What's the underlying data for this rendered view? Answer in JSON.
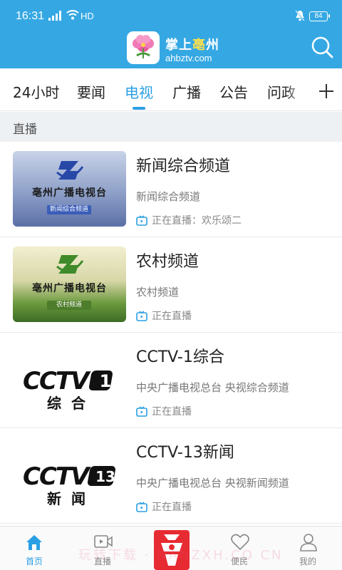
{
  "status_bar": {
    "time": "16:31",
    "network": "HD",
    "battery": "84"
  },
  "header": {
    "app_name_part1": "掌上",
    "app_name_part2": "亳",
    "app_name_part3": "州",
    "app_url": "ahbztv.com"
  },
  "tabs": [
    {
      "label": "24小时"
    },
    {
      "label": "要闻"
    },
    {
      "label": "电视",
      "active": true
    },
    {
      "label": "广播"
    },
    {
      "label": "公告"
    },
    {
      "label": "问政"
    }
  ],
  "section_label": "直播",
  "channels": [
    {
      "title": "新闻综合频道",
      "subtitle": "新闻综合频道",
      "live_status": "正在直播：欢乐颂二",
      "thumb_text": "亳州广播电视台",
      "thumb_band": "新闻综合频道"
    },
    {
      "title": "农村频道",
      "subtitle": "农村频道",
      "live_status": "正在直播",
      "thumb_text": "亳州广播电视台",
      "thumb_band": "农村频道"
    },
    {
      "title": "CCTV-1综合",
      "subtitle": "中央广播电视总台 央视综合频道",
      "live_status": "正在直播",
      "thumb_logo": "CCTV",
      "thumb_num": "1",
      "thumb_sub": "综合"
    },
    {
      "title": "CCTV-13新闻",
      "subtitle": "中央广播电视总台 央视新闻频道",
      "live_status": "正在直播",
      "thumb_logo": "CCTV",
      "thumb_num": "13",
      "thumb_sub": "新闻"
    }
  ],
  "bottom_nav": [
    {
      "label": "首页",
      "icon": "home-icon",
      "active": true
    },
    {
      "label": "直播",
      "icon": "video-icon"
    },
    {
      "label": "",
      "icon": "center-logo-icon"
    },
    {
      "label": "便民",
      "icon": "heart-icon"
    },
    {
      "label": "我的",
      "icon": "user-icon"
    }
  ],
  "watermark": "玩转下载 · NANZXH.CO CN",
  "colors": {
    "primary": "#35a8e4",
    "accent": "#2a9fe3",
    "center_button": "#e72b32"
  }
}
